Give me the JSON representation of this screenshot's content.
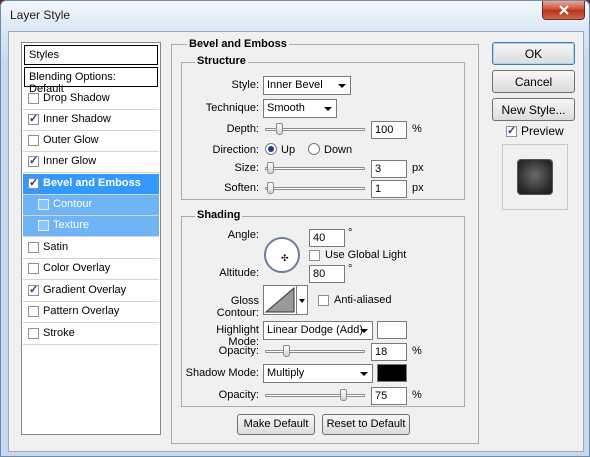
{
  "window": {
    "title": "Layer Style"
  },
  "styles_list": {
    "header": "Styles",
    "blending_options": "Blending Options: Default",
    "items": [
      {
        "label": "Drop Shadow",
        "checked": false
      },
      {
        "label": "Inner Shadow",
        "checked": true
      },
      {
        "label": "Outer Glow",
        "checked": false
      },
      {
        "label": "Inner Glow",
        "checked": true
      },
      {
        "label": "Bevel and Emboss",
        "checked": true,
        "selected": true
      },
      {
        "label": "Contour",
        "checked": false,
        "sub": true
      },
      {
        "label": "Texture",
        "checked": false,
        "sub": true
      },
      {
        "label": "Satin",
        "checked": false
      },
      {
        "label": "Color Overlay",
        "checked": false
      },
      {
        "label": "Gradient Overlay",
        "checked": true
      },
      {
        "label": "Pattern Overlay",
        "checked": false
      },
      {
        "label": "Stroke",
        "checked": false
      }
    ]
  },
  "bevel": {
    "section_title": "Bevel and Emboss",
    "structure": {
      "title": "Structure",
      "style_label": "Style:",
      "style_value": "Inner Bevel",
      "technique_label": "Technique:",
      "technique_value": "Smooth",
      "depth_label": "Depth:",
      "depth_value": "100",
      "depth_unit": "%",
      "direction_label": "Direction:",
      "direction_up": "Up",
      "direction_down": "Down",
      "size_label": "Size:",
      "size_value": "3",
      "size_unit": "px",
      "soften_label": "Soften:",
      "soften_value": "1",
      "soften_unit": "px"
    },
    "shading": {
      "title": "Shading",
      "angle_label": "Angle:",
      "angle_value": "40",
      "angle_unit": "°",
      "global_light_label": "Use Global Light",
      "altitude_label": "Altitude:",
      "altitude_value": "80",
      "altitude_unit": "°",
      "gloss_contour_label": "Gloss Contour:",
      "anti_aliased_label": "Anti-aliased",
      "highlight_mode_label": "Highlight Mode:",
      "highlight_mode_value": "Linear Dodge (Add)",
      "highlight_color": "#ffffff",
      "highlight_opacity_label": "Opacity:",
      "highlight_opacity_value": "18",
      "highlight_opacity_unit": "%",
      "shadow_mode_label": "Shadow Mode:",
      "shadow_mode_value": "Multiply",
      "shadow_color": "#000000",
      "shadow_opacity_label": "Opacity:",
      "shadow_opacity_value": "75",
      "shadow_opacity_unit": "%"
    },
    "make_default": "Make Default",
    "reset_default": "Reset to Default"
  },
  "buttons": {
    "ok": "OK",
    "cancel": "Cancel",
    "new_style": "New Style...",
    "preview_label": "Preview"
  }
}
